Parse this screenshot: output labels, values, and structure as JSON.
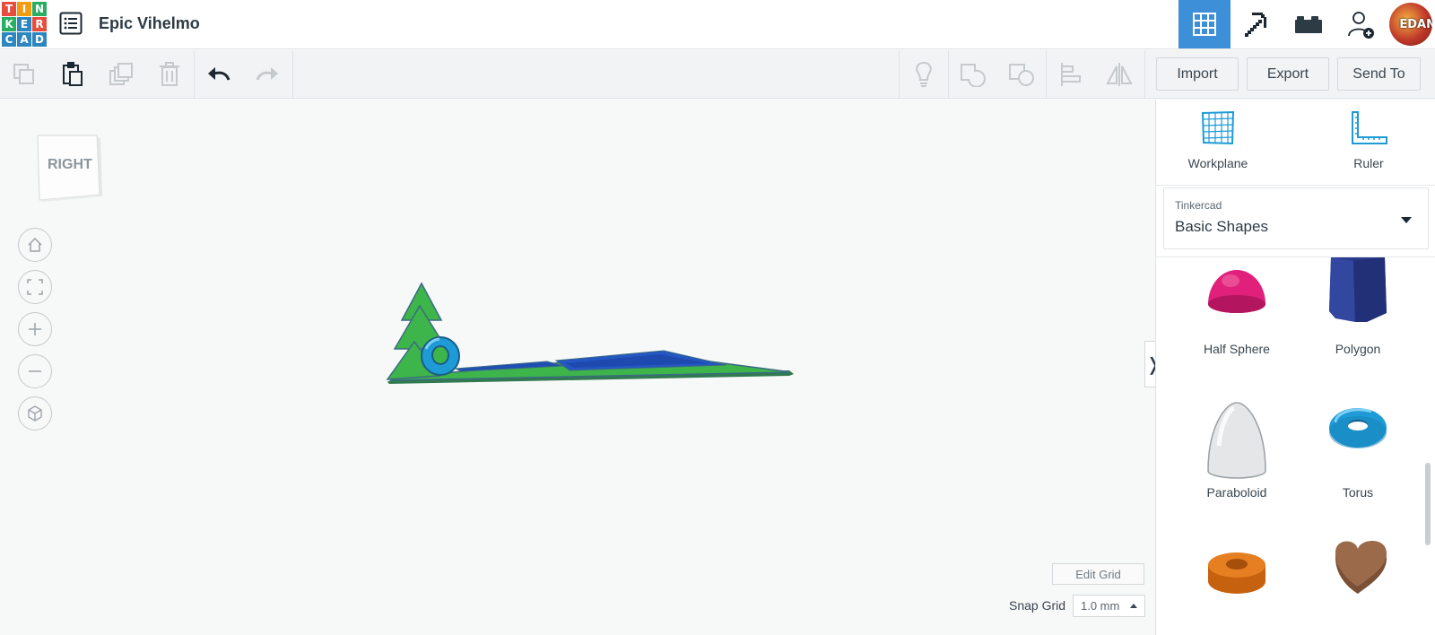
{
  "app": {
    "logo_letters": [
      "T",
      "I",
      "N",
      "K",
      "E",
      "R",
      "C",
      "A",
      "D"
    ],
    "logo_colors": [
      "#e74c3c",
      "#f39c12",
      "#f1c40f",
      "#27ae60",
      "#16a085",
      "#2e86c1",
      "#2e86c1",
      "#2e86c1",
      "#2e86c1"
    ],
    "design_title": "Epic Vihelmo",
    "accent_color": "#3d8fd8"
  },
  "topbar": {
    "views": [
      {
        "name": "3d-design-view",
        "icon": "grid-icon",
        "active": true
      },
      {
        "name": "blocks-view",
        "icon": "pickaxe-icon",
        "active": false
      },
      {
        "name": "bricks-view",
        "icon": "brick-icon",
        "active": false
      },
      {
        "name": "invite-user",
        "icon": "add-user-icon",
        "active": false
      }
    ],
    "avatar_text": "EDAN"
  },
  "toolbar": {
    "import_label": "Import",
    "export_label": "Export",
    "send_to_label": "Send To"
  },
  "viewport": {
    "viewcube_label": "RIGHT",
    "edit_grid_label": "Edit Grid",
    "snap_grid_label": "Snap Grid",
    "snap_grid_value": "1.0 mm",
    "collapse_glyph": "❭"
  },
  "sidebar": {
    "workplane_label": "Workplane",
    "ruler_label": "Ruler",
    "library_category": "Tinkercad",
    "library_value": "Basic Shapes",
    "shapes": [
      {
        "label": "Half Sphere",
        "color": "#e0207a"
      },
      {
        "label": "Polygon",
        "color": "#2a3a8c"
      },
      {
        "label": "Paraboloid",
        "color": "#e8e8e8"
      },
      {
        "label": "Torus",
        "color": "#1e9bd7"
      },
      {
        "label": "",
        "color": "#e67e22"
      },
      {
        "label": "",
        "color": "#9a6a4a"
      }
    ]
  }
}
